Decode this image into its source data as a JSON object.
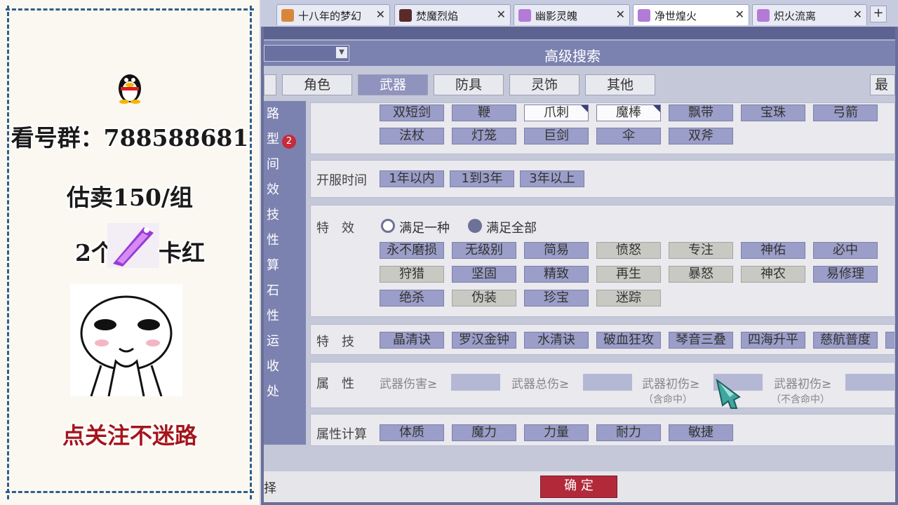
{
  "streamer_panel": {
    "group_line": "看号群：788588681",
    "price_line": "估卖150/组",
    "count_text": "2个",
    "status_text": "卡红",
    "footer_text": "点关注不迷路"
  },
  "browser": {
    "tabs": [
      {
        "label": "十八年的梦幻",
        "close": "✕"
      },
      {
        "label": "焚魔烈焰",
        "close": "✕"
      },
      {
        "label": "幽影灵魄",
        "close": "✕"
      },
      {
        "label": "净世煌火",
        "close": "✕"
      },
      {
        "label": "炽火流离",
        "close": "✕"
      }
    ],
    "new_tab": "+"
  },
  "dialog": {
    "title": "高级搜索",
    "categories": [
      "角色",
      "武器",
      "防具",
      "灵饰",
      "其他"
    ],
    "cat_right_partial": "最",
    "side_nav": [
      "路",
      "型",
      "间",
      "效",
      "技",
      "性",
      "算",
      "石",
      "性",
      "运",
      "收",
      "处"
    ],
    "side_badge": "2",
    "weapon_types": [
      [
        "双短剑",
        "鞭",
        "爪刺",
        "魔棒",
        "飘带",
        "宝珠",
        "弓箭"
      ],
      [
        "法杖",
        "灯笼",
        "巨剑",
        "伞",
        "双斧"
      ]
    ],
    "server_time": {
      "label": "开服时间",
      "options": [
        "1年以内",
        "1到3年",
        "3年以上"
      ]
    },
    "effects": {
      "label": "特　效",
      "match_any": "满足一种",
      "match_all": "满足全部",
      "rows": [
        [
          "永不磨损",
          "无级别",
          "简易",
          "愤怒",
          "专注",
          "神佑",
          "必中"
        ],
        [
          "狩猎",
          "坚固",
          "精致",
          "再生",
          "暴怒",
          "神农",
          "易修理"
        ],
        [
          "绝杀",
          "伪装",
          "珍宝",
          "迷踪"
        ]
      ]
    },
    "skills": {
      "label": "特　技",
      "items": [
        "晶清诀",
        "罗汉金钟",
        "水清诀",
        "破血狂攻",
        "琴音三叠",
        "四海升平",
        "慈航普度"
      ]
    },
    "attributes": {
      "label": "属　性",
      "fields": [
        {
          "label": "武器伤害≥",
          "sub": ""
        },
        {
          "label": "武器总伤≥",
          "sub": ""
        },
        {
          "label": "武器初伤≥",
          "sub": "（含命中）"
        },
        {
          "label": "武器初伤≥",
          "sub": "（不含命中）"
        }
      ]
    },
    "attr_calc": {
      "label": "属性计算",
      "items": [
        "体质",
        "魔力",
        "力量",
        "耐力",
        "敏捷"
      ]
    },
    "footer_left": "择",
    "confirm": "确 定"
  }
}
